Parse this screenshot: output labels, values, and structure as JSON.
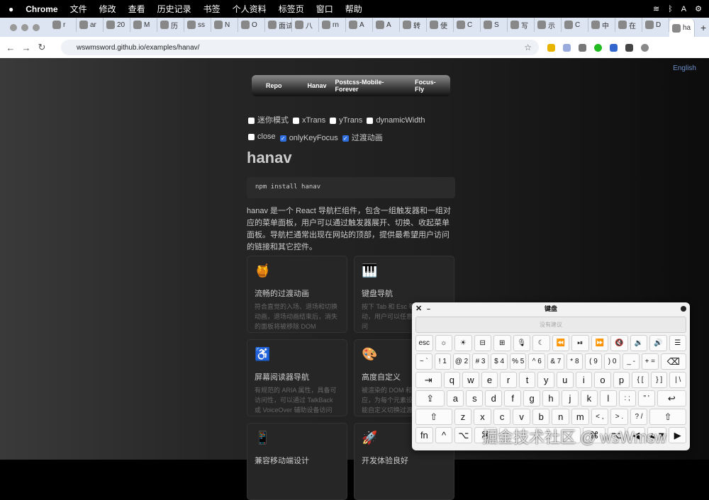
{
  "menubar": {
    "app": "Chrome",
    "items": [
      "文件",
      "修改",
      "查看",
      "历史记录",
      "书签",
      "个人资料",
      "标签页",
      "窗口",
      "帮助"
    ]
  },
  "tabs": [
    "r",
    "ar",
    "20",
    "M",
    "历",
    "ss",
    "N",
    "O",
    "面试",
    "八",
    "rn",
    "A",
    "A",
    "转",
    "使",
    "C",
    "S",
    "写",
    "示",
    "C",
    "中",
    "在",
    "D",
    "ha"
  ],
  "address": {
    "url": "wswmsword.github.io/examples/hanav/"
  },
  "page": {
    "lang": "English",
    "nav": [
      "Repo",
      "Hanav",
      "Postcss-Mobile-Forever",
      "Focus-Fly"
    ],
    "options": [
      {
        "label": "迷你模式",
        "checked": false
      },
      {
        "label": "xTrans",
        "checked": false
      },
      {
        "label": "yTrans",
        "checked": false
      },
      {
        "label": "dynamicWidth",
        "checked": false
      },
      {
        "label": "close",
        "checked": false
      },
      {
        "label": "onlyKeyFocus",
        "checked": true
      },
      {
        "label": "过渡动画",
        "checked": true
      }
    ],
    "title": "hanav",
    "install": "npm install hanav",
    "description": "hanav 是一个 React 导航栏组件，包含一组触发器和一组对应的菜单面板，用户可以通过触发器展开、切换、收起菜单面板。导航栏通常出现在网站的顶部，提供最希望用户访问的链接和其它控件。",
    "cards": [
      {
        "icon": "🍯",
        "title": "流畅的过渡动画",
        "desc": "符合直觉的入场、退场和切换动画，退场动画结束后，消失的面板将被移除 DOM"
      },
      {
        "icon": "🎹",
        "title": "键盘导航",
        "desc": "按下 Tab 和 Esc 等按键移动，用户可以任意通过键盘访问"
      },
      {
        "icon": "♿",
        "title": "屏幕阅读器导航",
        "desc": "有规范的 ARIA 属性，具备可访问性，可以通过 TalkBack 或 VoiceOver 辅助设备访问"
      },
      {
        "icon": "🎨",
        "title": "高度自定义",
        "desc": "被渲染的 DOM 和样式一一对应，为每个元素设置样式，还能自定义切换过渡"
      },
      {
        "icon": "📱",
        "title": "兼容移动端设计",
        "desc": ""
      },
      {
        "icon": "🚀",
        "title": "开发体验良好",
        "desc": ""
      }
    ]
  },
  "keyboard": {
    "title": "键盘",
    "suggestion": "没有建议",
    "rows": [
      [
        "esc",
        "☼",
        "☀",
        "⊟",
        "⊞",
        "🎙",
        "☾",
        "⏪",
        "⏯",
        "⏩",
        "🔇",
        "🔉",
        "🔊",
        "☰"
      ],
      [
        "~ `",
        "! 1",
        "@ 2",
        "# 3",
        "$ 4",
        "% 5",
        "^ 6",
        "& 7",
        "* 8",
        "( 9",
        ") 0",
        "_ -",
        "+ =",
        "⌫"
      ],
      [
        "⇥",
        "q",
        "w",
        "e",
        "r",
        "t",
        "y",
        "u",
        "i",
        "o",
        "p",
        "{ [",
        "} ]",
        "| \\"
      ],
      [
        "⇪",
        "a",
        "s",
        "d",
        "f",
        "g",
        "h",
        "j",
        "k",
        "l",
        ": ;",
        "\" '",
        "↩"
      ],
      [
        "⇧",
        "z",
        "x",
        "c",
        "v",
        "b",
        "n",
        "m",
        "< ,",
        "> .",
        "? /",
        "⇧"
      ],
      [
        "fn",
        "^",
        "⌥",
        "⌘",
        " ",
        "⌘",
        "⌥",
        "◀",
        "▲▼",
        "▶"
      ]
    ]
  },
  "watermark": "掘金技术社区 @ wsWmsw"
}
